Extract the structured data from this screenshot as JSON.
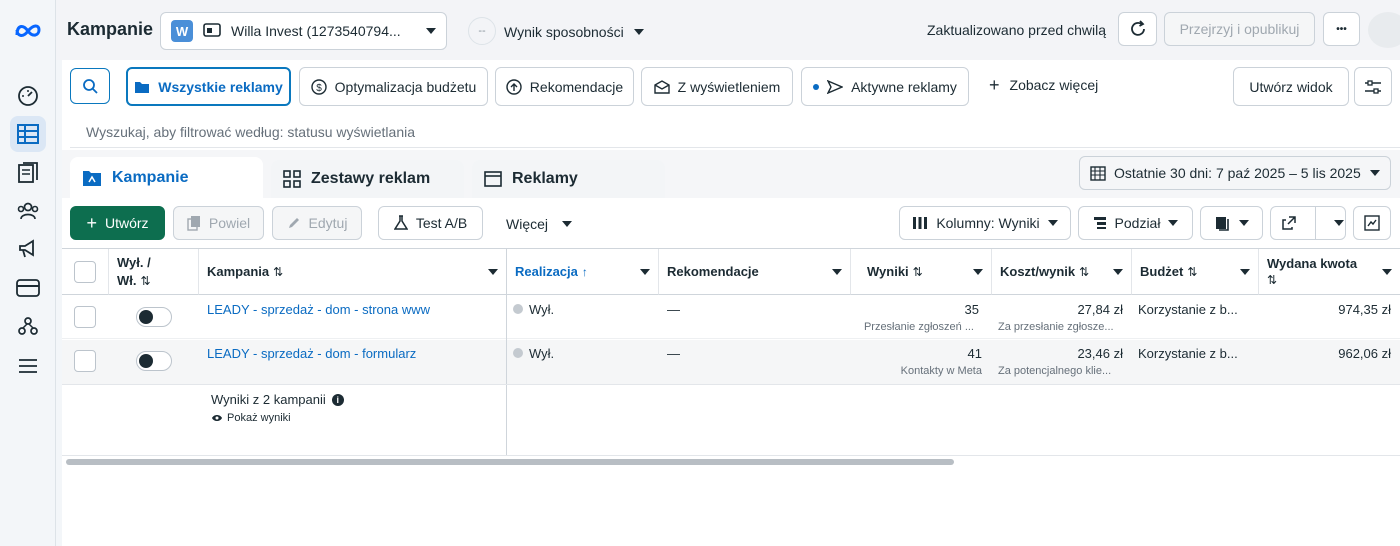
{
  "topbar": {
    "title": "Kampanie",
    "account_badge": "W",
    "account_name": "Willa Invest (1273540794...",
    "score_label": "Wynik sposobności",
    "score_dash": "--",
    "updated": "Zaktualizowano przed chwilą",
    "review_button": "Przejrzyj i opublikuj",
    "more_icon": "•••"
  },
  "filters": {
    "all_ads": "Wszystkie reklamy",
    "budget_opt": "Optymalizacja budżetu",
    "recommendations": "Rekomendacje",
    "with_impressions": "Z wyświetleniem",
    "active_ads": "Aktywne reklamy",
    "see_more": "Zobacz więcej",
    "create_view": "Utwórz widok"
  },
  "search": {
    "placeholder": "Wyszukaj, aby filtrować według: statusu wyświetlania"
  },
  "tabs": [
    {
      "label": "Kampanie"
    },
    {
      "label": "Zestawy reklam"
    },
    {
      "label": "Reklamy"
    }
  ],
  "date_range": "Ostatnie 30 dni: 7 paź 2025 – 5 lis 2025",
  "toolbar": {
    "create": "Utwórz",
    "duplicate": "Powiel",
    "edit": "Edytuj",
    "ab_test": "Test A/B",
    "more": "Więcej",
    "columns": "Kolumny: Wyniki",
    "breakdown": "Podział"
  },
  "table": {
    "headers": {
      "onoff_line1": "Wył. /",
      "onoff_line2": "Wł.",
      "campaign": "Kampania",
      "delivery": "Realizacja",
      "recommendations": "Rekomendacje",
      "results": "Wyniki",
      "cost": "Koszt/wynik",
      "budget": "Budżet",
      "spent": "Wydana kwota"
    },
    "rows": [
      {
        "name": "LEADY - sprzedaż - dom - strona www",
        "delivery": "Wył.",
        "recommendation": "—",
        "results": "35",
        "results_sub": "Przesłanie zgłoszeń ...",
        "cost": "27,84 zł",
        "cost_sub": "Za przesłanie zgłosze...",
        "budget": "Korzystanie z b...",
        "spent": "974,35 zł"
      },
      {
        "name": "LEADY - sprzedaż - dom - formularz",
        "delivery": "Wył.",
        "recommendation": "—",
        "results": "41",
        "results_sub": "Kontakty w Meta",
        "cost": "23,46 zł",
        "cost_sub": "Za potencjalnego klie...",
        "budget": "Korzystanie z b...",
        "spent": "962,06 zł"
      }
    ],
    "summary": "Wyniki z 2 kampanii",
    "show_results": "Pokaż wyniki"
  }
}
